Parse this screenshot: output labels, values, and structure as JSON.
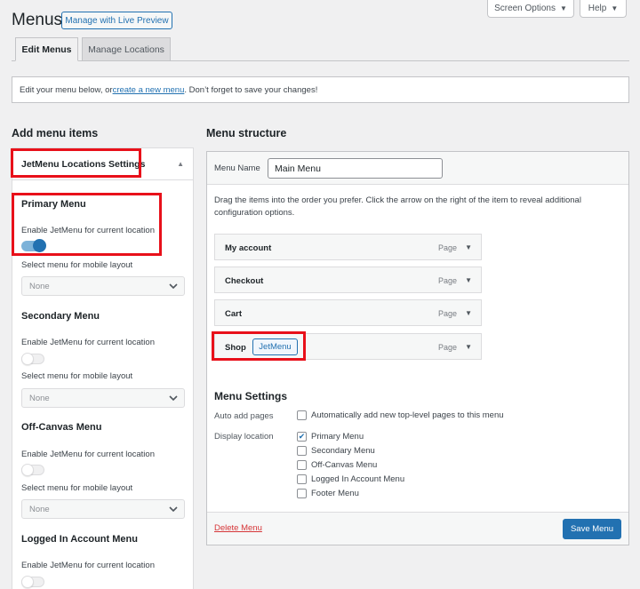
{
  "header": {
    "title": "Menus",
    "live_preview_label": "Manage with Live Preview",
    "screen_options_label": "Screen Options",
    "help_label": "Help"
  },
  "tabs": [
    {
      "label": "Edit Menus",
      "active": true
    },
    {
      "label": "Manage Locations",
      "active": false
    }
  ],
  "notice": {
    "before": "Edit your menu below, or ",
    "link": "create a new menu",
    "after": ". Don’t forget to save your changes!"
  },
  "left": {
    "heading": "Add menu items",
    "accordion_title": "JetMenu Locations Settings",
    "locations": [
      {
        "title": "Primary Menu",
        "enable_label": "Enable JetMenu for current location",
        "enabled": true,
        "mobile_label": "Select menu for mobile layout",
        "mobile_value": "None"
      },
      {
        "title": "Secondary Menu",
        "enable_label": "Enable JetMenu for current location",
        "enabled": false,
        "mobile_label": "Select menu for mobile layout",
        "mobile_value": "None"
      },
      {
        "title": "Off-Canvas Menu",
        "enable_label": "Enable JetMenu for current location",
        "enabled": false,
        "mobile_label": "Select menu for mobile layout",
        "mobile_value": "None"
      },
      {
        "title": "Logged In Account Menu",
        "enable_label": "Enable JetMenu for current location",
        "enabled": false
      }
    ]
  },
  "right": {
    "heading": "Menu structure",
    "name_label": "Menu Name",
    "name_value": "Main Menu",
    "instructions": "Drag the items into the order you prefer. Click the arrow on the right of the item to reveal additional configuration options.",
    "items": [
      {
        "title": "My account",
        "type": "Page"
      },
      {
        "title": "Checkout",
        "type": "Page"
      },
      {
        "title": "Cart",
        "type": "Page"
      },
      {
        "title": "Shop",
        "type": "Page",
        "badge": "JetMenu"
      }
    ],
    "settings": {
      "heading": "Menu Settings",
      "auto_add_label": "Auto add pages",
      "auto_add_text": "Automatically add new top-level pages to this menu",
      "display_label": "Display location",
      "locations": [
        {
          "label": "Primary Menu",
          "checked": true
        },
        {
          "label": "Secondary Menu",
          "checked": false
        },
        {
          "label": "Off-Canvas Menu",
          "checked": false
        },
        {
          "label": "Logged In Account Menu",
          "checked": false
        },
        {
          "label": "Footer Menu",
          "checked": false
        }
      ]
    },
    "delete_label": "Delete Menu",
    "save_label": "Save Menu"
  },
  "colors": {
    "accent": "#2271b1",
    "highlight": "#e8101a",
    "danger": "#d63638"
  }
}
